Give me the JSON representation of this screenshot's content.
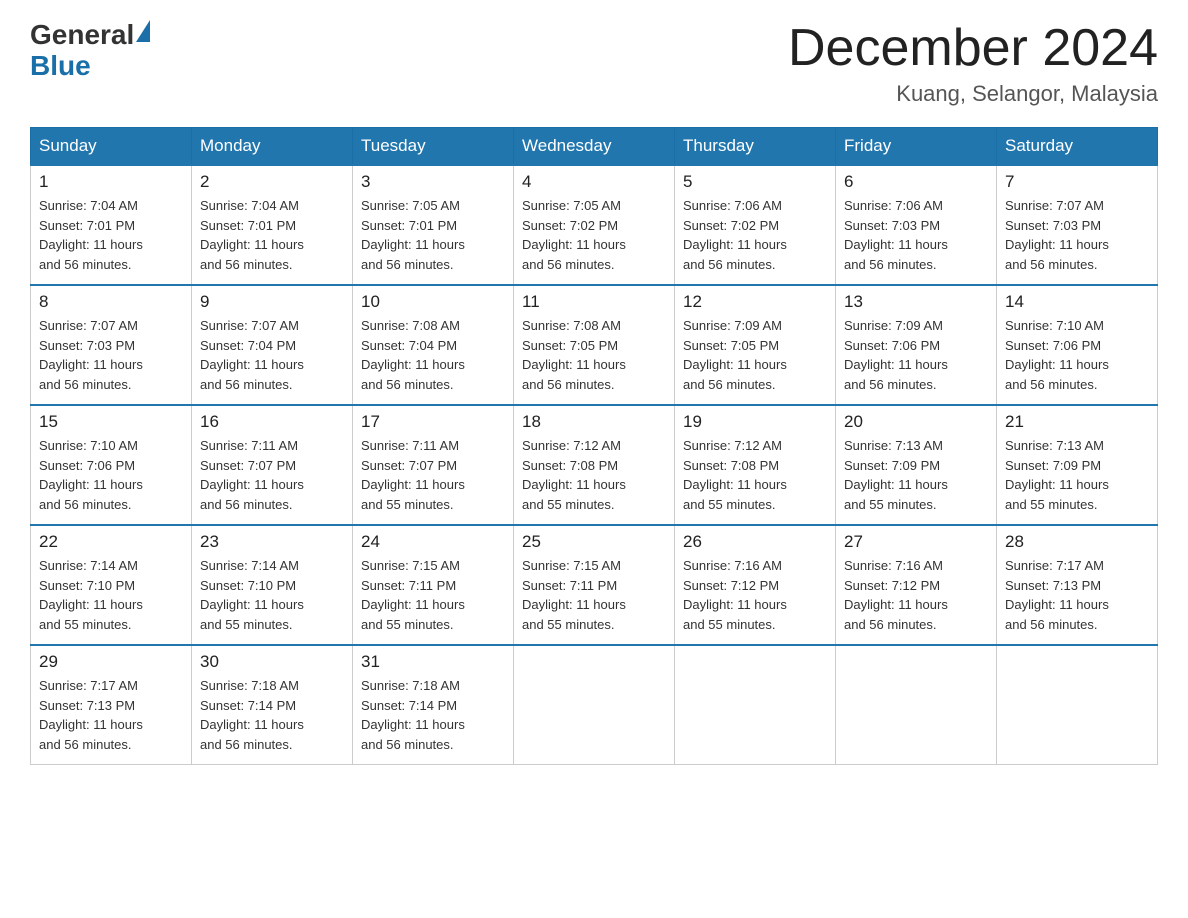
{
  "header": {
    "logo_general": "General",
    "logo_blue": "Blue",
    "title": "December 2024",
    "subtitle": "Kuang, Selangor, Malaysia"
  },
  "weekdays": [
    "Sunday",
    "Monday",
    "Tuesday",
    "Wednesday",
    "Thursday",
    "Friday",
    "Saturday"
  ],
  "weeks": [
    [
      {
        "day": "1",
        "sunrise": "7:04 AM",
        "sunset": "7:01 PM",
        "daylight": "11 hours and 56 minutes."
      },
      {
        "day": "2",
        "sunrise": "7:04 AM",
        "sunset": "7:01 PM",
        "daylight": "11 hours and 56 minutes."
      },
      {
        "day": "3",
        "sunrise": "7:05 AM",
        "sunset": "7:01 PM",
        "daylight": "11 hours and 56 minutes."
      },
      {
        "day": "4",
        "sunrise": "7:05 AM",
        "sunset": "7:02 PM",
        "daylight": "11 hours and 56 minutes."
      },
      {
        "day": "5",
        "sunrise": "7:06 AM",
        "sunset": "7:02 PM",
        "daylight": "11 hours and 56 minutes."
      },
      {
        "day": "6",
        "sunrise": "7:06 AM",
        "sunset": "7:03 PM",
        "daylight": "11 hours and 56 minutes."
      },
      {
        "day": "7",
        "sunrise": "7:07 AM",
        "sunset": "7:03 PM",
        "daylight": "11 hours and 56 minutes."
      }
    ],
    [
      {
        "day": "8",
        "sunrise": "7:07 AM",
        "sunset": "7:03 PM",
        "daylight": "11 hours and 56 minutes."
      },
      {
        "day": "9",
        "sunrise": "7:07 AM",
        "sunset": "7:04 PM",
        "daylight": "11 hours and 56 minutes."
      },
      {
        "day": "10",
        "sunrise": "7:08 AM",
        "sunset": "7:04 PM",
        "daylight": "11 hours and 56 minutes."
      },
      {
        "day": "11",
        "sunrise": "7:08 AM",
        "sunset": "7:05 PM",
        "daylight": "11 hours and 56 minutes."
      },
      {
        "day": "12",
        "sunrise": "7:09 AM",
        "sunset": "7:05 PM",
        "daylight": "11 hours and 56 minutes."
      },
      {
        "day": "13",
        "sunrise": "7:09 AM",
        "sunset": "7:06 PM",
        "daylight": "11 hours and 56 minutes."
      },
      {
        "day": "14",
        "sunrise": "7:10 AM",
        "sunset": "7:06 PM",
        "daylight": "11 hours and 56 minutes."
      }
    ],
    [
      {
        "day": "15",
        "sunrise": "7:10 AM",
        "sunset": "7:06 PM",
        "daylight": "11 hours and 56 minutes."
      },
      {
        "day": "16",
        "sunrise": "7:11 AM",
        "sunset": "7:07 PM",
        "daylight": "11 hours and 56 minutes."
      },
      {
        "day": "17",
        "sunrise": "7:11 AM",
        "sunset": "7:07 PM",
        "daylight": "11 hours and 55 minutes."
      },
      {
        "day": "18",
        "sunrise": "7:12 AM",
        "sunset": "7:08 PM",
        "daylight": "11 hours and 55 minutes."
      },
      {
        "day": "19",
        "sunrise": "7:12 AM",
        "sunset": "7:08 PM",
        "daylight": "11 hours and 55 minutes."
      },
      {
        "day": "20",
        "sunrise": "7:13 AM",
        "sunset": "7:09 PM",
        "daylight": "11 hours and 55 minutes."
      },
      {
        "day": "21",
        "sunrise": "7:13 AM",
        "sunset": "7:09 PM",
        "daylight": "11 hours and 55 minutes."
      }
    ],
    [
      {
        "day": "22",
        "sunrise": "7:14 AM",
        "sunset": "7:10 PM",
        "daylight": "11 hours and 55 minutes."
      },
      {
        "day": "23",
        "sunrise": "7:14 AM",
        "sunset": "7:10 PM",
        "daylight": "11 hours and 55 minutes."
      },
      {
        "day": "24",
        "sunrise": "7:15 AM",
        "sunset": "7:11 PM",
        "daylight": "11 hours and 55 minutes."
      },
      {
        "day": "25",
        "sunrise": "7:15 AM",
        "sunset": "7:11 PM",
        "daylight": "11 hours and 55 minutes."
      },
      {
        "day": "26",
        "sunrise": "7:16 AM",
        "sunset": "7:12 PM",
        "daylight": "11 hours and 55 minutes."
      },
      {
        "day": "27",
        "sunrise": "7:16 AM",
        "sunset": "7:12 PM",
        "daylight": "11 hours and 56 minutes."
      },
      {
        "day": "28",
        "sunrise": "7:17 AM",
        "sunset": "7:13 PM",
        "daylight": "11 hours and 56 minutes."
      }
    ],
    [
      {
        "day": "29",
        "sunrise": "7:17 AM",
        "sunset": "7:13 PM",
        "daylight": "11 hours and 56 minutes."
      },
      {
        "day": "30",
        "sunrise": "7:18 AM",
        "sunset": "7:14 PM",
        "daylight": "11 hours and 56 minutes."
      },
      {
        "day": "31",
        "sunrise": "7:18 AM",
        "sunset": "7:14 PM",
        "daylight": "11 hours and 56 minutes."
      },
      null,
      null,
      null,
      null
    ]
  ],
  "labels": {
    "sunrise": "Sunrise:",
    "sunset": "Sunset:",
    "daylight": "Daylight:"
  }
}
